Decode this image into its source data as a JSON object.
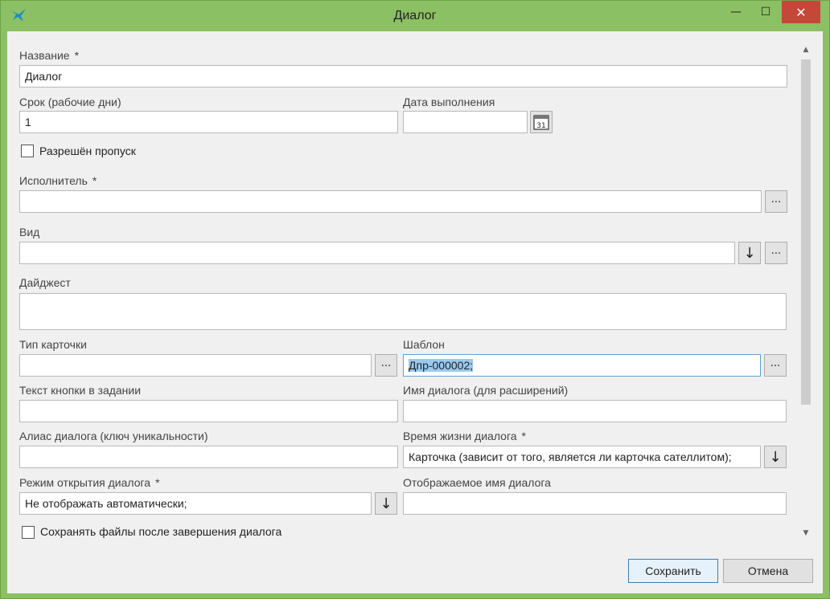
{
  "window": {
    "title": "Диалог",
    "buttons": {
      "minimize": "—",
      "maximize": "☐",
      "close": "✕"
    }
  },
  "form": {
    "name": {
      "label": "Название",
      "required_mark": "*",
      "value": "Диалог"
    },
    "term": {
      "label": "Срок (рабочие дни)",
      "value": "1"
    },
    "due_date": {
      "label": "Дата выполнения",
      "value": "",
      "calendar_day": "31"
    },
    "skip_allowed": {
      "label": "Разрешён пропуск",
      "checked": false
    },
    "executor": {
      "label": "Исполнитель",
      "required_mark": "*",
      "value": "",
      "browse": "..."
    },
    "kind": {
      "label": "Вид",
      "value": "",
      "dropdown": "↓",
      "browse": "..."
    },
    "digest": {
      "label": "Дайджест",
      "value": ""
    },
    "card_type": {
      "label": "Тип карточки",
      "value": "",
      "browse": "..."
    },
    "template": {
      "label": "Шаблон",
      "value": "Дпр-000002;",
      "browse": "..."
    },
    "button_text": {
      "label": "Текст кнопки в задании",
      "value": ""
    },
    "dialog_name_ext": {
      "label": "Имя диалога (для расширений)",
      "value": ""
    },
    "dialog_alias": {
      "label": "Алиас диалога (ключ уникальности)",
      "value": ""
    },
    "dialog_lifetime": {
      "label": "Время жизни диалога",
      "required_mark": "*",
      "value": "Карточка (зависит от того, является ли карточка сателлитом);",
      "dropdown": "↓"
    },
    "open_mode": {
      "label": "Режим открытия диалога",
      "required_mark": "*",
      "value": "Не отображать автоматически;",
      "dropdown": "↓"
    },
    "display_name": {
      "label": "Отображаемое имя диалога",
      "value": ""
    },
    "keep_files": {
      "label": "Сохранять файлы после завершения диалога",
      "checked": false
    }
  },
  "footer": {
    "save": "Сохранить",
    "cancel": "Отмена"
  },
  "scrollbar": {
    "up": "▲",
    "down": "▼"
  },
  "colors": {
    "frame": "#8cc064",
    "close": "#c7463a",
    "selection": "#99c9ef",
    "focus": "#5fa0da"
  }
}
